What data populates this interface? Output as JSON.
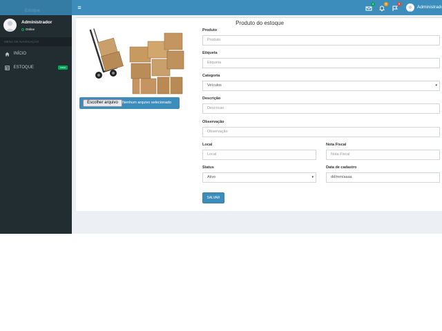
{
  "brand": {
    "logo_text": "Estoque"
  },
  "topbar": {
    "menu_icon": "hamburger-icon",
    "notifications": [
      {
        "icon": "envelope-icon",
        "count": "4",
        "color": "#00a65a"
      },
      {
        "icon": "bell-icon",
        "count": "9",
        "color": "#f39c12"
      },
      {
        "icon": "flag-icon",
        "count": "9",
        "color": "#dd4b39"
      }
    ],
    "user_name": "Administrador"
  },
  "sidebar": {
    "user_name": "Administrador",
    "status": "Online",
    "section_header": "MENU DE NAVEGAÇÃO",
    "items": [
      {
        "label": "INÍCIO",
        "icon": "home-icon"
      },
      {
        "label": "ESTOQUE",
        "icon": "table-icon",
        "badge": "novo"
      }
    ]
  },
  "image_panel": {
    "file_button": "Escolher arquivo",
    "file_status": "Nenhum arquivo selecionado"
  },
  "form": {
    "title": "Produto do estoque",
    "produto": {
      "label": "Produto",
      "placeholder": "Produto"
    },
    "etiqueta": {
      "label": "Etiqueta",
      "placeholder": "Etiqueta"
    },
    "categoria": {
      "label": "Categoria",
      "value": "Veículos"
    },
    "descricao": {
      "label": "Descrição",
      "placeholder": "Descricao"
    },
    "observacao": {
      "label": "Observação",
      "placeholder": "Observação"
    },
    "local": {
      "label": "Local",
      "placeholder": "Local"
    },
    "nota_fiscal": {
      "label": "Nota Fiscal",
      "placeholder": "Nota Fiscal"
    },
    "status": {
      "label": "Status",
      "value": "Ativo"
    },
    "data_cadastro": {
      "label": "Data de cadastro",
      "value": "dd/mm/aaaa"
    },
    "submit": "SALVAR"
  },
  "colors": {
    "header": "#3c8dbc",
    "logo_bg": "#357ca5",
    "sidebar": "#222d32",
    "content_bg": "#ecf0f5"
  }
}
